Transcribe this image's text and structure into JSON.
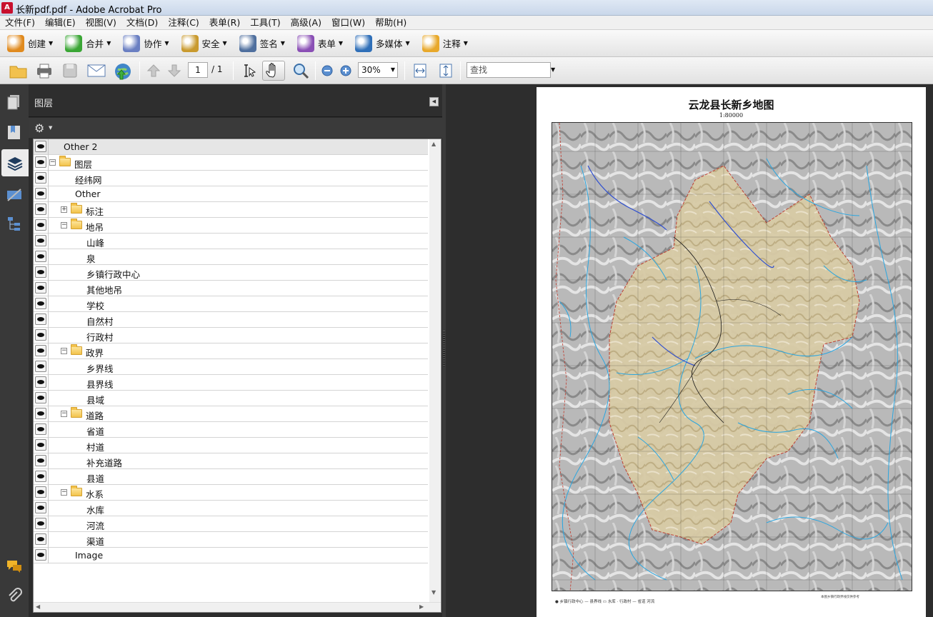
{
  "window": {
    "title": "长新pdf.pdf - Adobe Acrobat Pro"
  },
  "menu": [
    "文件(F)",
    "编辑(E)",
    "视图(V)",
    "文档(D)",
    "注释(C)",
    "表单(R)",
    "工具(T)",
    "高级(A)",
    "窗口(W)",
    "帮助(H)"
  ],
  "toolbar1": [
    {
      "label": "创建",
      "icon": "create-icon",
      "color": "#e08a1e"
    },
    {
      "label": "合并",
      "icon": "combine-icon",
      "color": "#3aa635"
    },
    {
      "label": "协作",
      "icon": "collaborate-icon",
      "color": "#6a7fc2"
    },
    {
      "label": "安全",
      "icon": "lock-icon",
      "color": "#c99a2e"
    },
    {
      "label": "签名",
      "icon": "pen-icon",
      "color": "#4f6f9e"
    },
    {
      "label": "表单",
      "icon": "form-icon",
      "color": "#8a4fb5"
    },
    {
      "label": "多媒体",
      "icon": "multimedia-icon",
      "color": "#2f6fb8"
    },
    {
      "label": "注释",
      "icon": "comment-icon",
      "color": "#e8a82a"
    }
  ],
  "toolbar2": {
    "page_current": "1",
    "page_total": "/ 1",
    "zoom": "30%",
    "search_placeholder": "查找"
  },
  "panel": {
    "title": "图层"
  },
  "layers": [
    {
      "label": "Other 2",
      "level": 0,
      "folder": false,
      "expander": "",
      "selected": true
    },
    {
      "label": "图层",
      "level": 0,
      "folder": true,
      "expander": "−"
    },
    {
      "label": "经纬网",
      "level": 1,
      "folder": false,
      "expander": ""
    },
    {
      "label": "Other",
      "level": 1,
      "folder": false,
      "expander": ""
    },
    {
      "label": "标注",
      "level": 1,
      "folder": true,
      "expander": "+"
    },
    {
      "label": "地吊",
      "level": 1,
      "folder": true,
      "expander": "−"
    },
    {
      "label": "山峰",
      "level": 2,
      "folder": false,
      "expander": ""
    },
    {
      "label": "泉",
      "level": 2,
      "folder": false,
      "expander": ""
    },
    {
      "label": "乡镇行政中心",
      "level": 2,
      "folder": false,
      "expander": ""
    },
    {
      "label": "其他地吊",
      "level": 2,
      "folder": false,
      "expander": ""
    },
    {
      "label": "学校",
      "level": 2,
      "folder": false,
      "expander": ""
    },
    {
      "label": "自然村",
      "level": 2,
      "folder": false,
      "expander": ""
    },
    {
      "label": "行政村",
      "level": 2,
      "folder": false,
      "expander": ""
    },
    {
      "label": "政界",
      "level": 1,
      "folder": true,
      "expander": "−"
    },
    {
      "label": "乡界线",
      "level": 2,
      "folder": false,
      "expander": ""
    },
    {
      "label": "县界线",
      "level": 2,
      "folder": false,
      "expander": ""
    },
    {
      "label": "县域",
      "level": 2,
      "folder": false,
      "expander": ""
    },
    {
      "label": "道路",
      "level": 1,
      "folder": true,
      "expander": "−"
    },
    {
      "label": "省道",
      "level": 2,
      "folder": false,
      "expander": ""
    },
    {
      "label": "村道",
      "level": 2,
      "folder": false,
      "expander": ""
    },
    {
      "label": "补充道路",
      "level": 2,
      "folder": false,
      "expander": ""
    },
    {
      "label": "县道",
      "level": 2,
      "folder": false,
      "expander": ""
    },
    {
      "label": "水系",
      "level": 1,
      "folder": true,
      "expander": "−"
    },
    {
      "label": "水库",
      "level": 2,
      "folder": false,
      "expander": ""
    },
    {
      "label": "河流",
      "level": 2,
      "folder": false,
      "expander": ""
    },
    {
      "label": "渠道",
      "level": 2,
      "folder": false,
      "expander": ""
    },
    {
      "label": "Image",
      "level": 1,
      "folder": false,
      "expander": ""
    }
  ],
  "document": {
    "map_title": "云龙县长新乡地图",
    "map_scale": "1:80000"
  },
  "colors": {
    "panel_bg": "#2c2c2c",
    "doc_bg": "#2d2d2d",
    "river": "#2aa6e0",
    "boundary": "#c0392b",
    "town_area": "#d8cba6"
  }
}
